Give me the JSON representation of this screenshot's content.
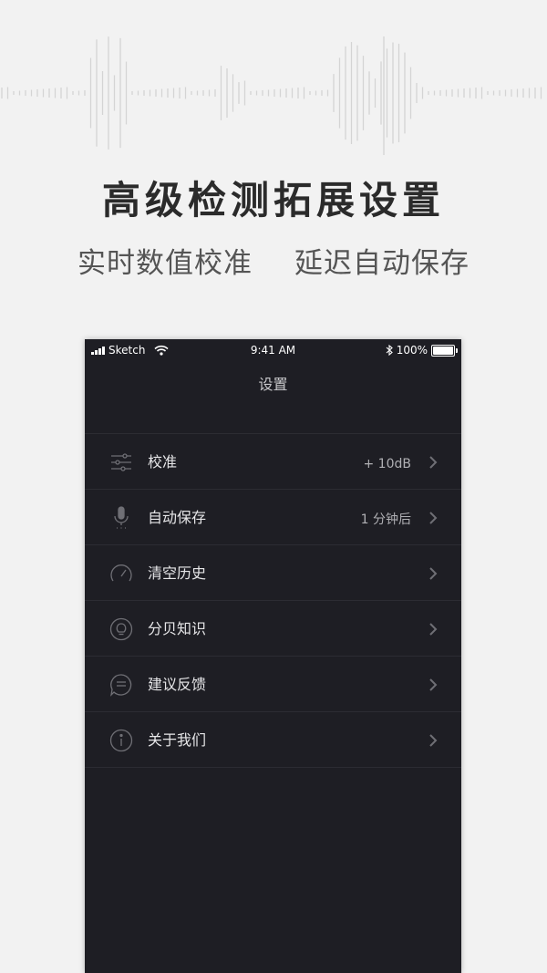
{
  "hero": {
    "title": "高级检测拓展设置",
    "subtitle_left": "实时数值校准",
    "subtitle_right": "延迟自动保存"
  },
  "statusbar": {
    "carrier": "Sketch",
    "time": "9:41 AM",
    "battery": "100%",
    "battery_level": 1.0
  },
  "screen": {
    "title": "设置"
  },
  "settings": [
    {
      "label": "校准",
      "value": "+ 10dB",
      "icon": "sliders-icon"
    },
    {
      "label": "自动保存",
      "value": "1 分钟后",
      "icon": "microphone-icon"
    },
    {
      "label": "清空历史",
      "value": "",
      "icon": "gauge-icon"
    },
    {
      "label": "分贝知识",
      "value": "",
      "icon": "lightbulb-icon"
    },
    {
      "label": "建议反馈",
      "value": "",
      "icon": "chat-icon"
    },
    {
      "label": "关于我们",
      "value": "",
      "icon": "info-icon"
    }
  ],
  "colors": {
    "background": "#f2f2f2",
    "screen_background": "#1e1e24",
    "divider": "#2c2c33",
    "icon": "#6f6f75",
    "text": "#e6e6e8"
  }
}
